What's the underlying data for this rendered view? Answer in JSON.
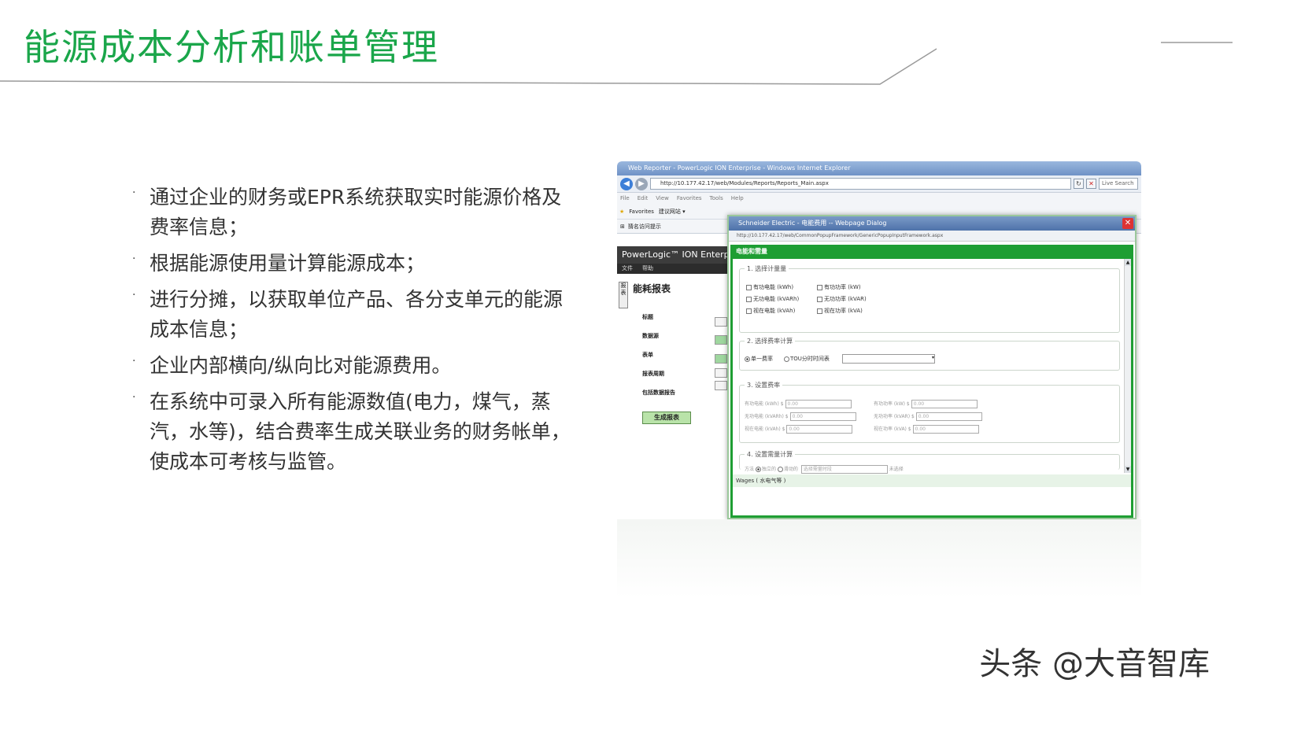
{
  "slide": {
    "title": "能源成本分析和账单管理",
    "accent_color": "#1aa64a",
    "bullet_marker": "·",
    "bullets": [
      "通过企业的财务或EPR系统获取实时能源价格及费率信息；",
      "根据能源使用量计算能源成本；",
      "进行分摊，以获取单位产品、各分支单元的能源成本信息；",
      "企业内部横向/纵向比对能源费用。",
      "在系统中可录入所有能源数值(电力，煤气，蒸汽，水等)，结合费率生成关联业务的财务帐单，使成本可考核与监管。"
    ],
    "watermark": "头条 @大音智库"
  },
  "screenshot": {
    "window_title": "Web Reporter - PowerLogic ION Enterprise - Windows Internet Explorer",
    "address": "http://10.177.42.17/web/Modules/Reports/Reports_Main.aspx",
    "live_search": "Live Search",
    "menu": [
      "File",
      "Edit",
      "View",
      "Favorites",
      "Tools",
      "Help"
    ],
    "favorites": {
      "label": "Favorites",
      "item": "建议网站 ▾"
    },
    "tab_label": "猜名访问提示",
    "app_banner": "PowerLogic™ ION Enterprise",
    "app_menu": [
      "文件",
      "帮助"
    ],
    "left_pane": {
      "vtab": "报表",
      "title": "能耗报表",
      "rows": [
        "标题",
        "数据源",
        "表单",
        "报表周期",
        "包括数据报告"
      ],
      "generate_button": "生成报表"
    },
    "dialog": {
      "title": "Schneider Electric - 电能费用 -- Webpage Dialog",
      "url": "http://10.177.42.17/web/CommonPopupFramework/GenericPopupInputFramework.aspx",
      "header": "电能和需量",
      "sec1": {
        "title": "1. 选择计量量",
        "left": [
          "有功电能 (kWh)",
          "无功电能 (kVARh)",
          "视在电能 (kVAh)"
        ],
        "right": [
          "有功功率 (kW)",
          "无功功率 (kVAR)",
          "视在功率 (kVA)"
        ]
      },
      "sec2": {
        "title": "2. 选择费率计算",
        "opt1": "单一费率",
        "opt2": "TOU分时时间表"
      },
      "sec3": {
        "title": "3. 设置费率",
        "left": [
          "有功电能 (kWh) $",
          "无功电能 (kVARh) $",
          "视在电能 (kVAh) $"
        ],
        "right": [
          "有功功率 (kW) $",
          "无功功率 (kVAR) $",
          "视在功率 (kVA) $"
        ],
        "value": "0.00"
      },
      "sec4": {
        "title": "4. 设置需量计算",
        "method": "方法",
        "opt1": "独立的",
        "opt2": "滑动的",
        "field": "选择需量时段",
        "status": "未选择"
      },
      "footer": "Wages ( 水电气等 )"
    }
  }
}
